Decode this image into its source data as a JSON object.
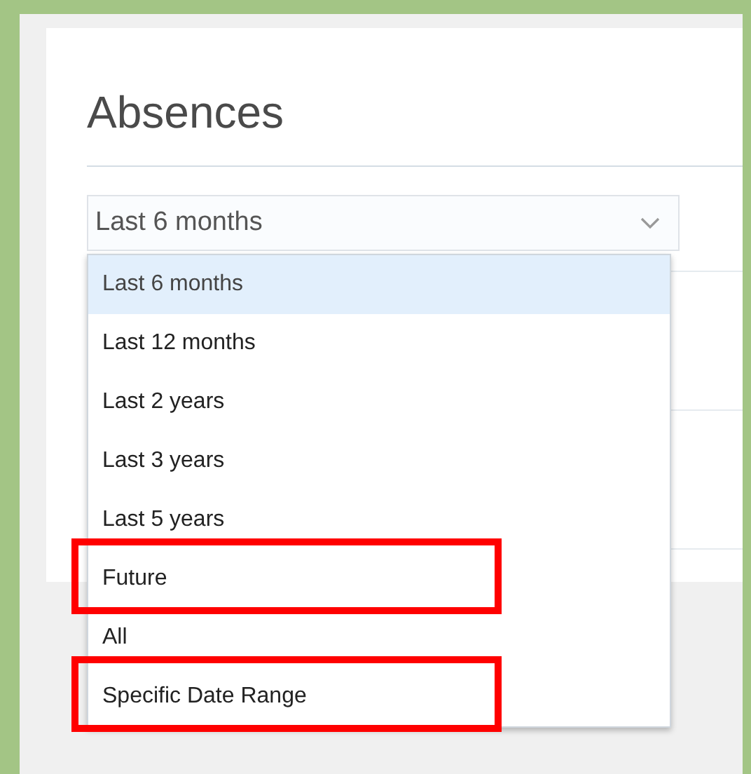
{
  "page": {
    "title": "Absences"
  },
  "period_select": {
    "value": "Last 6 months",
    "expanded": true,
    "options": [
      {
        "label": "Last 6 months",
        "selected": true,
        "highlighted": false
      },
      {
        "label": "Last 12 months",
        "selected": false,
        "highlighted": false
      },
      {
        "label": "Last 2 years",
        "selected": false,
        "highlighted": false
      },
      {
        "label": "Last 3 years",
        "selected": false,
        "highlighted": false
      },
      {
        "label": "Last 5 years",
        "selected": false,
        "highlighted": false
      },
      {
        "label": "Future",
        "selected": false,
        "highlighted": true
      },
      {
        "label": "All",
        "selected": false,
        "highlighted": false
      },
      {
        "label": "Specific Date Range",
        "selected": false,
        "highlighted": true
      }
    ]
  }
}
